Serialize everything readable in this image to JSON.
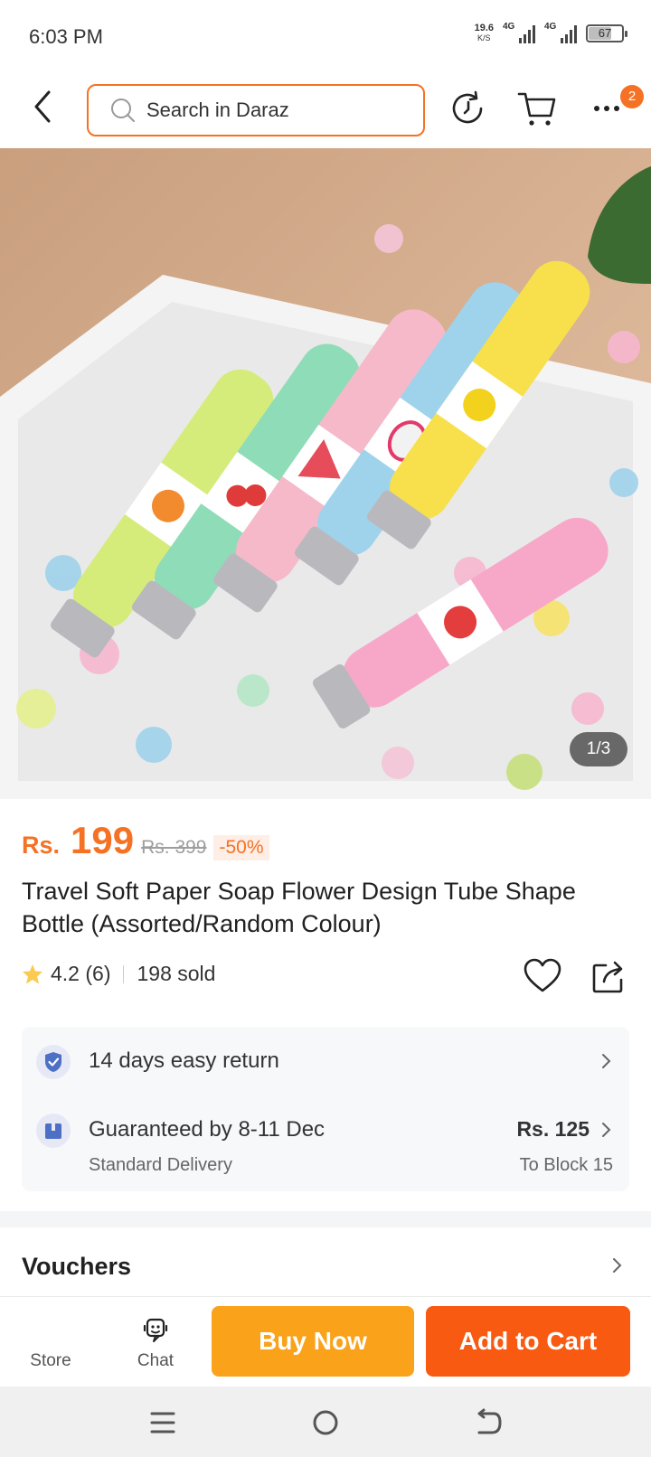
{
  "status_bar": {
    "time": "6:03 PM",
    "net_speed": "19.6",
    "net_speed_unit": "K/S",
    "signal_1": "4G",
    "signal_2": "4G",
    "battery": "67"
  },
  "header": {
    "search_placeholder": "Search in Daraz",
    "cart_badge": "2",
    "icons": [
      "back-arrow-icon",
      "search-icon",
      "history-icon",
      "cart-icon",
      "more-icon"
    ]
  },
  "gallery": {
    "counter": "1/3"
  },
  "product": {
    "currency": "Rs.",
    "price": "199",
    "original_price": "Rs. 399",
    "discount": "-50%",
    "title": "Travel Soft Paper Soap Flower Design Tube Shape Bottle (Assorted/Random Colour)",
    "rating": "4.2 (6)",
    "sold": "198 sold"
  },
  "services": {
    "return_text": "14 days easy return",
    "delivery_text": "Guaranteed by 8-11 Dec",
    "delivery_type": "Standard Delivery",
    "delivery_price": "Rs. 125",
    "delivery_destination": "To Block 15"
  },
  "vouchers": {
    "title": "Vouchers"
  },
  "action_bar": {
    "store_label": "Store",
    "chat_label": "Chat",
    "buy_now_label": "Buy Now",
    "add_to_cart_label": "Add to Cart"
  },
  "colors": {
    "accent": "#f57224",
    "buy_now": "#f9a21a",
    "add_to_cart": "#f85a12"
  }
}
